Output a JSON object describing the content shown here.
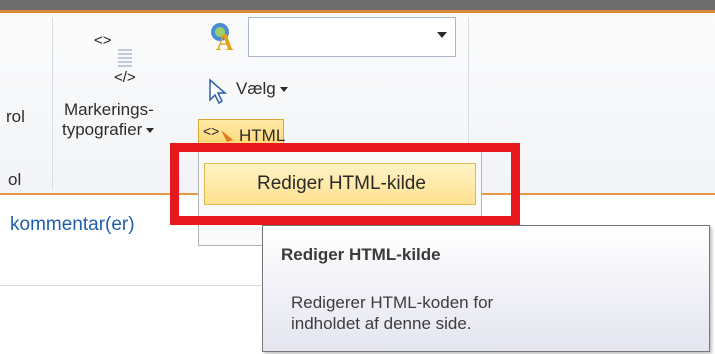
{
  "ribbon": {
    "left_cut_label": "rol",
    "left_group_label": "ol",
    "markup_styles_label_line1": "Markerings-",
    "markup_styles_label_line2": "typografier",
    "select_label": "Vælg",
    "html_button_label": "HTML",
    "combo_value": ""
  },
  "menu": {
    "items": [
      {
        "label": "Rediger HTML-kilde"
      }
    ]
  },
  "page": {
    "comment_link": "kommentar(er)"
  },
  "tooltip": {
    "title": "Rediger HTML-kilde",
    "body": "Redigerer HTML-koden for\nindholdet af denne side."
  },
  "colors": {
    "accent_orange": "#e69a45",
    "highlight_red": "#e6181d",
    "menu_hover": "#ffe190",
    "link_blue": "#1f5fa9"
  }
}
